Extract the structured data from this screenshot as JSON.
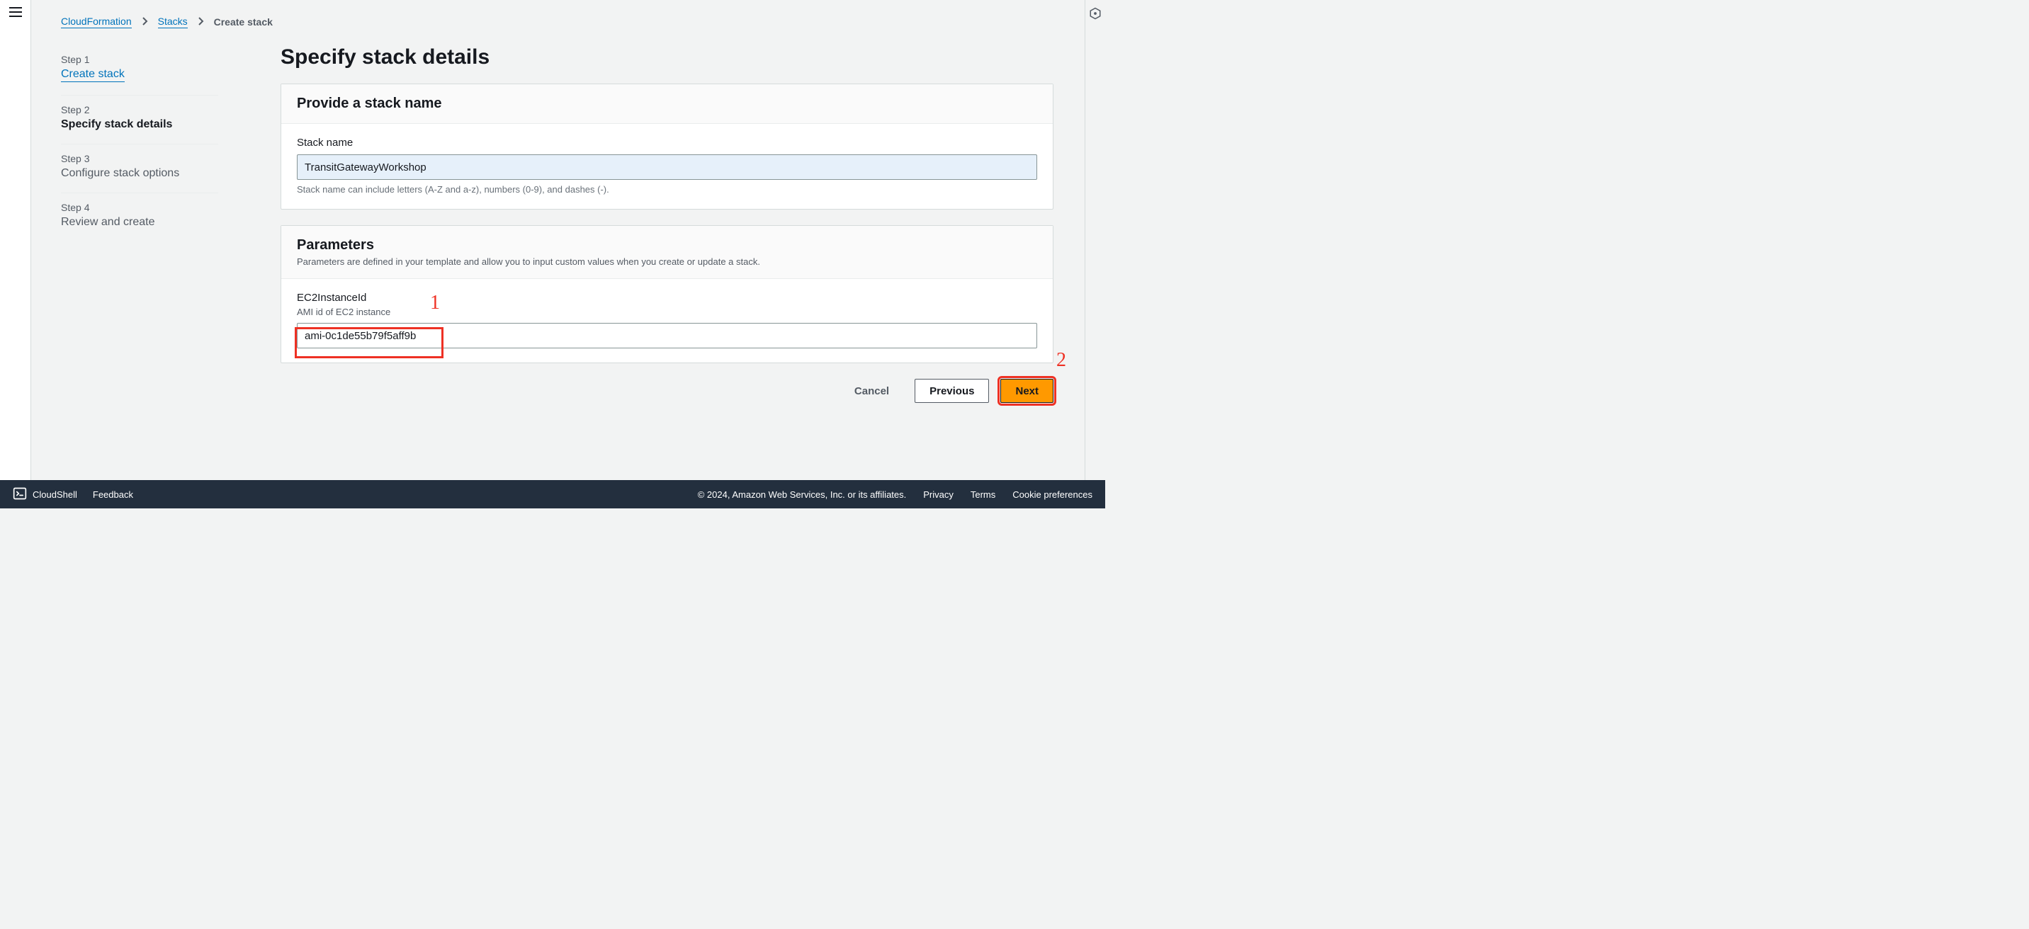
{
  "breadcrumbs": {
    "cloudformation": "CloudFormation",
    "stacks": "Stacks",
    "current": "Create stack"
  },
  "steps": [
    {
      "num": "Step 1",
      "title": "Create stack",
      "link": true,
      "active": false
    },
    {
      "num": "Step 2",
      "title": "Specify stack details",
      "link": false,
      "active": true
    },
    {
      "num": "Step 3",
      "title": "Configure stack options",
      "link": false,
      "active": false
    },
    {
      "num": "Step 4",
      "title": "Review and create",
      "link": false,
      "active": false
    }
  ],
  "page": {
    "title": "Specify stack details"
  },
  "panel_stack_name": {
    "heading": "Provide a stack name",
    "label": "Stack name",
    "value": "TransitGatewayWorkshop",
    "hint": "Stack name can include letters (A-Z and a-z), numbers (0-9), and dashes (-)."
  },
  "panel_parameters": {
    "heading": "Parameters",
    "subtitle": "Parameters are defined in your template and allow you to input custom values when you create or update a stack.",
    "param_label": "EC2InstanceId",
    "param_desc": "AMI id of EC2 instance",
    "param_value": "ami-0c1de55b79f5aff9b"
  },
  "actions": {
    "cancel": "Cancel",
    "previous": "Previous",
    "next": "Next"
  },
  "annotations": {
    "one": "1",
    "two": "2"
  },
  "footer": {
    "cloudshell": "CloudShell",
    "feedback": "Feedback",
    "copyright": "© 2024, Amazon Web Services, Inc. or its affiliates.",
    "privacy": "Privacy",
    "terms": "Terms",
    "cookie": "Cookie preferences"
  }
}
